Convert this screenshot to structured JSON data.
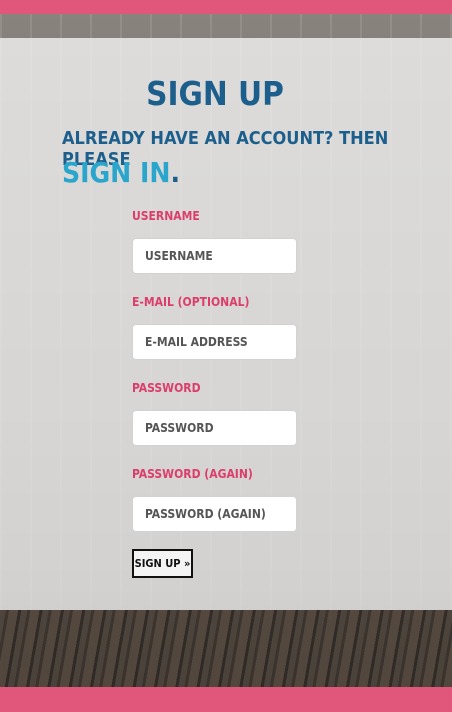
{
  "header": {
    "title": "SIGN UP",
    "subtitle": "ALREADY HAVE AN ACCOUNT? THEN PLEASE",
    "signin_link": "SIGN IN",
    "signin_suffix": "."
  },
  "form": {
    "username": {
      "label": "USERNAME",
      "placeholder": "USERNAME",
      "value": ""
    },
    "email": {
      "label": "E-MAIL (OPTIONAL)",
      "placeholder": "E-MAIL ADDRESS",
      "value": ""
    },
    "password": {
      "label": "PASSWORD",
      "placeholder": "PASSWORD",
      "value": ""
    },
    "password_again": {
      "label": "PASSWORD (AGAIN)",
      "placeholder": "PASSWORD (AGAIN)",
      "value": ""
    },
    "submit_label": "SIGN UP »"
  },
  "colors": {
    "accent_pink": "#e0577b",
    "title_blue": "#1d5f8c",
    "link_cyan": "#2aa6cc",
    "label_pink": "#dc3d6a"
  }
}
